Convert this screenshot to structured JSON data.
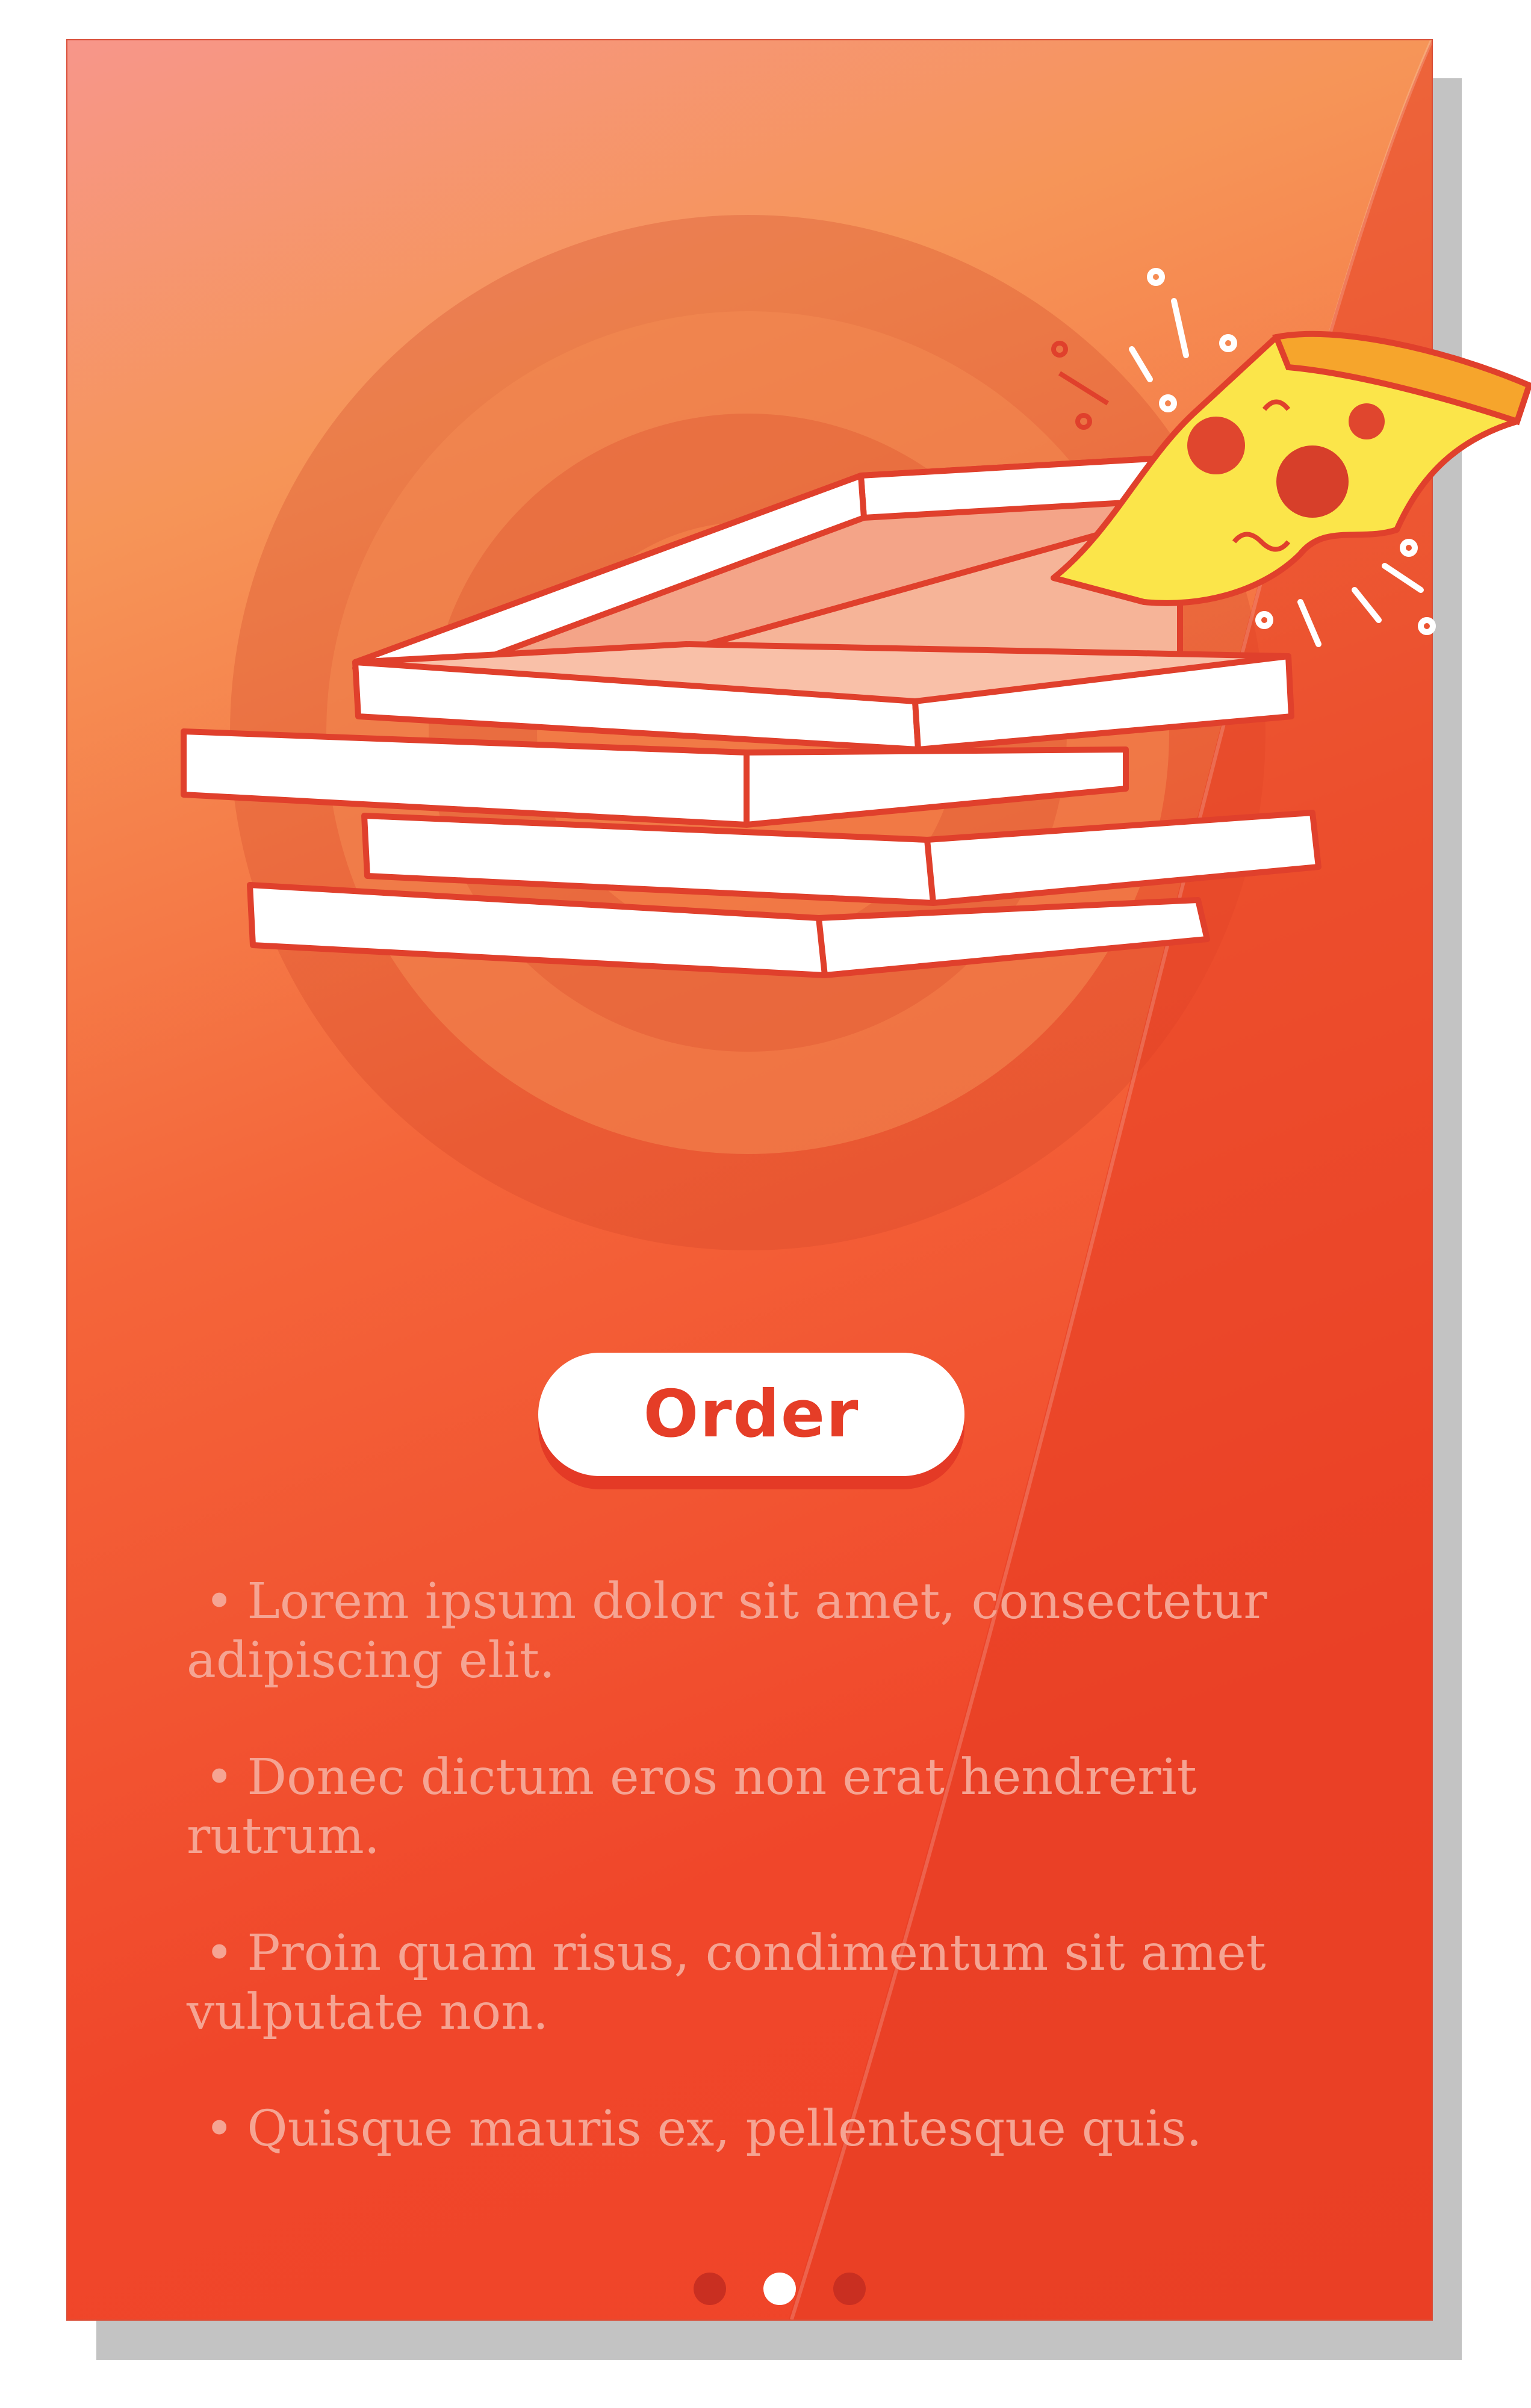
{
  "order_button": {
    "label": "Order"
  },
  "features": [
    {
      "bullet": "•",
      "text": "Lorem ipsum dolor sit amet, consectetur adipiscing elit."
    },
    {
      "bullet": "•",
      "text": "Donec dictum eros non erat hendrerit rutrum."
    },
    {
      "bullet": "•",
      "text": "Proin quam risus, condimentum sit amet vulputate non."
    },
    {
      "bullet": "•",
      "text": "Quisque mauris ex, pellentesque quis."
    }
  ],
  "pagination": {
    "total": 3,
    "active_index": 1
  },
  "colors": {
    "accent": "#e53d27",
    "card_top": "#f7968a",
    "card_bottom": "#ef4428",
    "feature_text": "#f5a493",
    "dot_inactive": "#c92f21",
    "dot_active": "#ffffff"
  },
  "icons": [
    "pizza-box-stack-illustration",
    "pizza-slice-icon"
  ]
}
